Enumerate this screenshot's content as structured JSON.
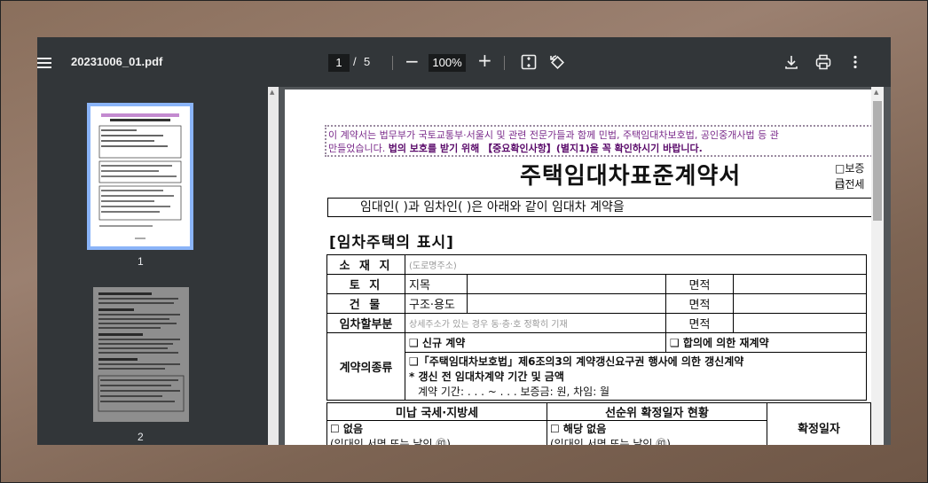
{
  "toolbar": {
    "filename": "20231006_01.pdf",
    "current_page": "1",
    "page_sep": "/",
    "total_pages": "5",
    "zoom": "100%",
    "zoom_out": "−",
    "zoom_in": "+"
  },
  "sidebar": {
    "thumbnails": [
      {
        "label": "1",
        "selected": true
      },
      {
        "label": "2",
        "selected": false
      }
    ]
  },
  "document": {
    "notice_line1": "이 계약서는 법무부가 국토교통부·서울시 및 관련 전문가들과 함께 민법, 주택임대차보호법, 공인중개사법 등 관",
    "notice_line2_plain": "만들었습니다.",
    "notice_line2_bold": "법의 보호를 받기 위해 【중요확인사항】(별지1)을 꼭 확인하시기 바랍니다.",
    "title": "주택임대차표준계약서",
    "opt1": "□보증금",
    "opt2": "□전세",
    "parties": "임대인(                        )과 임차인(                        )은 아래와 같이 임대차 계약을",
    "section_heading": "[임차주택의 표시]",
    "rows": {
      "location_label": "소 재 지",
      "location_value": "(도로명주소)",
      "land_label": "토   지",
      "land_type": "지목",
      "area_label": "면적",
      "building_label": "건   물",
      "building_type": "구조·용도",
      "lease_part_label": "임차할부분",
      "lease_part_value": "상세주소가 있는 경우 동·층·호 정확히 기재",
      "contract_type_label": "계약의종류",
      "new_contract": "❑ 신규 계약",
      "renewal_agreement": "❑ 합의에 의한 재계약",
      "renewal_right": "❑「주택임대차보호법」제6조의3의 계약갱신요구권 행사에 의한 갱신계약",
      "prev_info": "* 갱신 전 임대차계약 기간 및 금액",
      "prev_period": "계약 기간:     .    .    . ~     .    .    .    보증금:                     원,  차임: 월"
    },
    "bottom": {
      "tax_header": "미납 국세·지방세",
      "priority_header": "선순위 확정일자 현황",
      "none1": "☐ 없음",
      "none2": "☐ 해당 없음",
      "sign1": "(임대인 서명 또는 날인                    ㊞)",
      "sign2": "(임대인 서명 또는 날인                    ㊞)",
      "fixed_date": "확정일자"
    }
  },
  "colors": {
    "toolbar_bg": "#323639",
    "viewer_bg": "#525659",
    "selection": "#8ab4f8"
  }
}
